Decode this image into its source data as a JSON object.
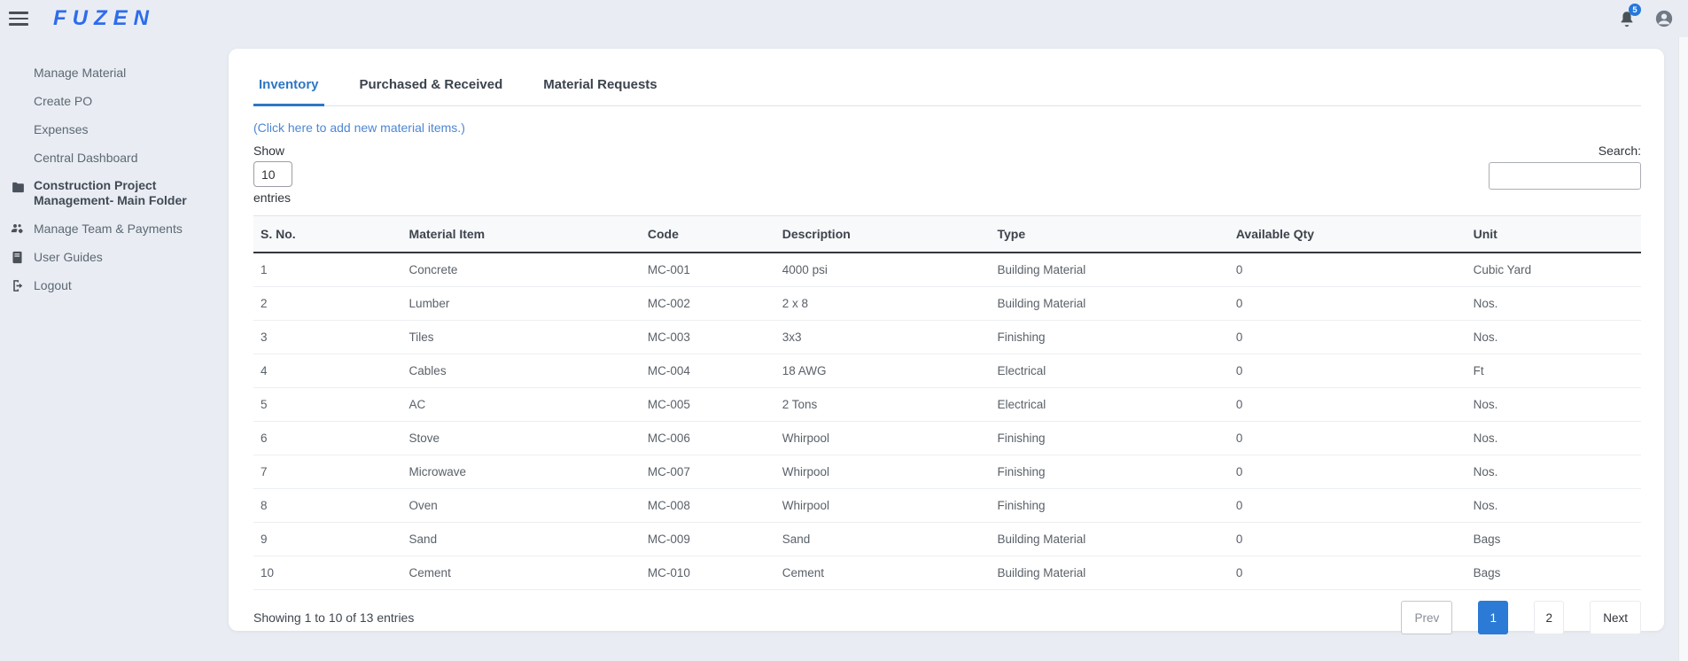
{
  "header": {
    "logo": "FUZEN",
    "notification_count": "5"
  },
  "sidebar": {
    "items": [
      {
        "label": "Manage Material"
      },
      {
        "label": "Create PO"
      },
      {
        "label": "Expenses"
      },
      {
        "label": "Central Dashboard"
      },
      {
        "label": "Construction Project Management- Main Folder",
        "icon": "folder-icon"
      },
      {
        "label": "Manage Team & Payments",
        "icon": "team-icon"
      },
      {
        "label": "User Guides",
        "icon": "book-icon"
      },
      {
        "label": "Logout",
        "icon": "logout-icon"
      }
    ]
  },
  "tabs": {
    "items": [
      {
        "label": "Inventory",
        "active": true
      },
      {
        "label": "Purchased & Received",
        "active": false
      },
      {
        "label": "Material Requests",
        "active": false
      }
    ]
  },
  "add_link": "(Click here to add new material items.)",
  "controls": {
    "show_label": "Show",
    "page_size": "10",
    "entries_label": "entries",
    "search_label": "Search:",
    "search_value": ""
  },
  "table": {
    "headers": [
      "S. No.",
      "Material Item",
      "Code",
      "Description",
      "Type",
      "Available Qty",
      "Unit"
    ],
    "rows": [
      [
        "1",
        "Concrete",
        "MC-001",
        "4000 psi",
        "Building Material",
        "0",
        "Cubic Yard"
      ],
      [
        "2",
        "Lumber",
        "MC-002",
        "2 x 8",
        "Building Material",
        "0",
        "Nos."
      ],
      [
        "3",
        "Tiles",
        "MC-003",
        "3x3",
        "Finishing",
        "0",
        "Nos."
      ],
      [
        "4",
        "Cables",
        "MC-004",
        "18 AWG",
        "Electrical",
        "0",
        "Ft"
      ],
      [
        "5",
        "AC",
        "MC-005",
        "2 Tons",
        "Electrical",
        "0",
        "Nos."
      ],
      [
        "6",
        "Stove",
        "MC-006",
        "Whirpool",
        "Finishing",
        "0",
        "Nos."
      ],
      [
        "7",
        "Microwave",
        "MC-007",
        "Whirpool",
        "Finishing",
        "0",
        "Nos."
      ],
      [
        "8",
        "Oven",
        "MC-008",
        "Whirpool",
        "Finishing",
        "0",
        "Nos."
      ],
      [
        "9",
        "Sand",
        "MC-009",
        "Sand",
        "Building Material",
        "0",
        "Bags"
      ],
      [
        "10",
        "Cement",
        "MC-010",
        "Cement",
        "Building Material",
        "0",
        "Bags"
      ]
    ]
  },
  "footer": {
    "info": "Showing 1 to 10 of 13 entries",
    "pagination": {
      "prev_label": "Prev",
      "pages": [
        "1",
        "2"
      ],
      "active_page": "1",
      "next_label": "Next"
    }
  },
  "colors": {
    "logo_blue": "#2e6bee",
    "tab_active_blue": "#2d77c4",
    "link_blue": "#4d86d3",
    "pagination_active_blue": "#2b7ad6",
    "notification_badge_blue": "#2478dd"
  }
}
